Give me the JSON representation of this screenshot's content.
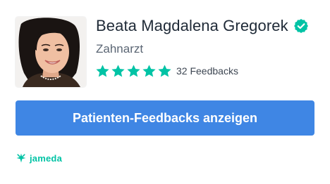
{
  "profile": {
    "name": "Beata Magdalena Gregorek",
    "specialty": "Zahnarzt",
    "verified_icon": "verified-check-icon",
    "photo_icon": "doctor-photo"
  },
  "rating": {
    "stars": 5,
    "max_stars": 5,
    "star_icon": "star-icon",
    "feedback_count_label": "32 Feedbacks"
  },
  "cta": {
    "label": "Patienten-Feedbacks anzeigen"
  },
  "brand": {
    "name": "jameda",
    "icon": "jameda-logo-icon"
  },
  "colors": {
    "accent_teal": "#00c3a5",
    "button_blue": "#3f86e4",
    "text_dark": "#1f2a37",
    "text_muted": "#5b6674"
  }
}
